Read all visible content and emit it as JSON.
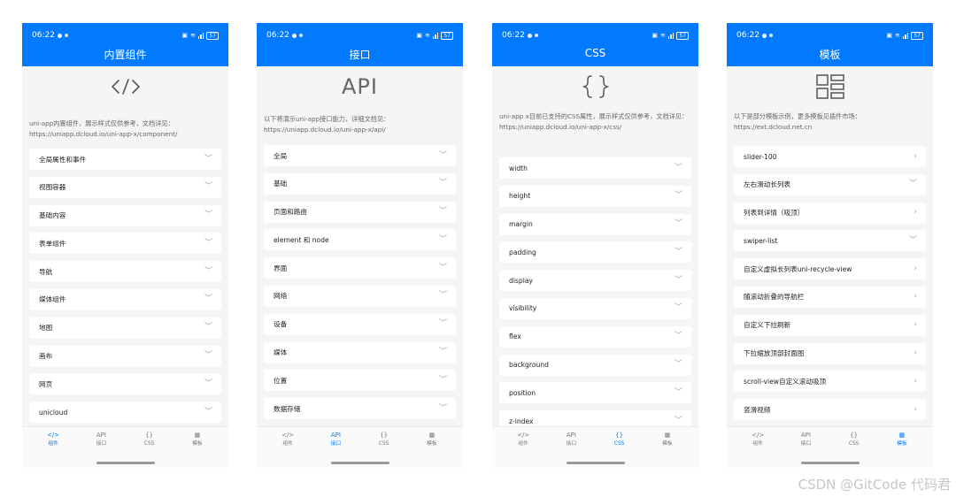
{
  "colors": {
    "primary": "#017aff",
    "background": "#f5f5f5",
    "card": "#ffffff"
  },
  "phones": [
    {
      "status": {
        "time": "06:22",
        "battery": "57"
      },
      "title": "内置组件",
      "hero_icon": "code-brackets-icon",
      "description": "uni-app内置组件，展示样式仅供参考，文档详见：https://uniapp.dcloud.io/uni-app-x/component/",
      "items": [
        "全局属性和事件",
        "视图容器",
        "基础内容",
        "表单组件",
        "导航",
        "媒体组件",
        "地图",
        "画布",
        "网页",
        "unicloud"
      ],
      "active_tab": 0
    },
    {
      "status": {
        "time": "06:22",
        "battery": "57"
      },
      "title": "接口",
      "hero_text": "API",
      "description": "以下将演示uni-app接口能力，详细文档见：https://uniapp.dcloud.io/uni-app-x/api/",
      "items": [
        "全局",
        "基础",
        "页面和路由",
        "element 和 node",
        "界面",
        "网络",
        "设备",
        "媒体",
        "位置",
        "数据存储"
      ],
      "active_tab": 1
    },
    {
      "status": {
        "time": "06:22",
        "battery": "57"
      },
      "title": "CSS",
      "hero_icon": "curly-braces-icon",
      "description": "uni-app x目前已支持的CSS属性，展示样式仅供参考，文档详见：https://uniapp.dcloud.io/uni-app-x/css/",
      "items": [
        "width",
        "height",
        "margin",
        "padding",
        "display",
        "visibility",
        "flex",
        "background",
        "position",
        "z-index"
      ],
      "active_tab": 2
    },
    {
      "status": {
        "time": "06:22",
        "battery": "57"
      },
      "title": "模板",
      "hero_icon": "template-grid-icon",
      "description": "以下是部分模板示例，更多模板见插件市场：https://ext.dcloud.net.cn",
      "items": [
        "slider-100",
        "左右滑动长列表",
        "列表到详情（吸顶）",
        "swiper-list",
        "自定义虚拟长列表uni-recycle-view",
        "随滚动折叠的导航栏",
        "自定义下拉刷新",
        "下拉缩放顶部封面图",
        "scroll-view自定义滚动吸顶",
        "竖滑视频"
      ],
      "item_arrows": [
        "right",
        "down",
        "right",
        "down",
        "right",
        "right",
        "right",
        "right",
        "right",
        "right"
      ],
      "active_tab": 3
    }
  ],
  "tabbar": [
    {
      "icon": "</>",
      "label": "组件"
    },
    {
      "icon": "API",
      "label": "接口"
    },
    {
      "icon": "{}",
      "label": "CSS"
    },
    {
      "icon": "▦",
      "label": "模板"
    }
  ],
  "watermark": "CSDN @GitCode 代码君"
}
